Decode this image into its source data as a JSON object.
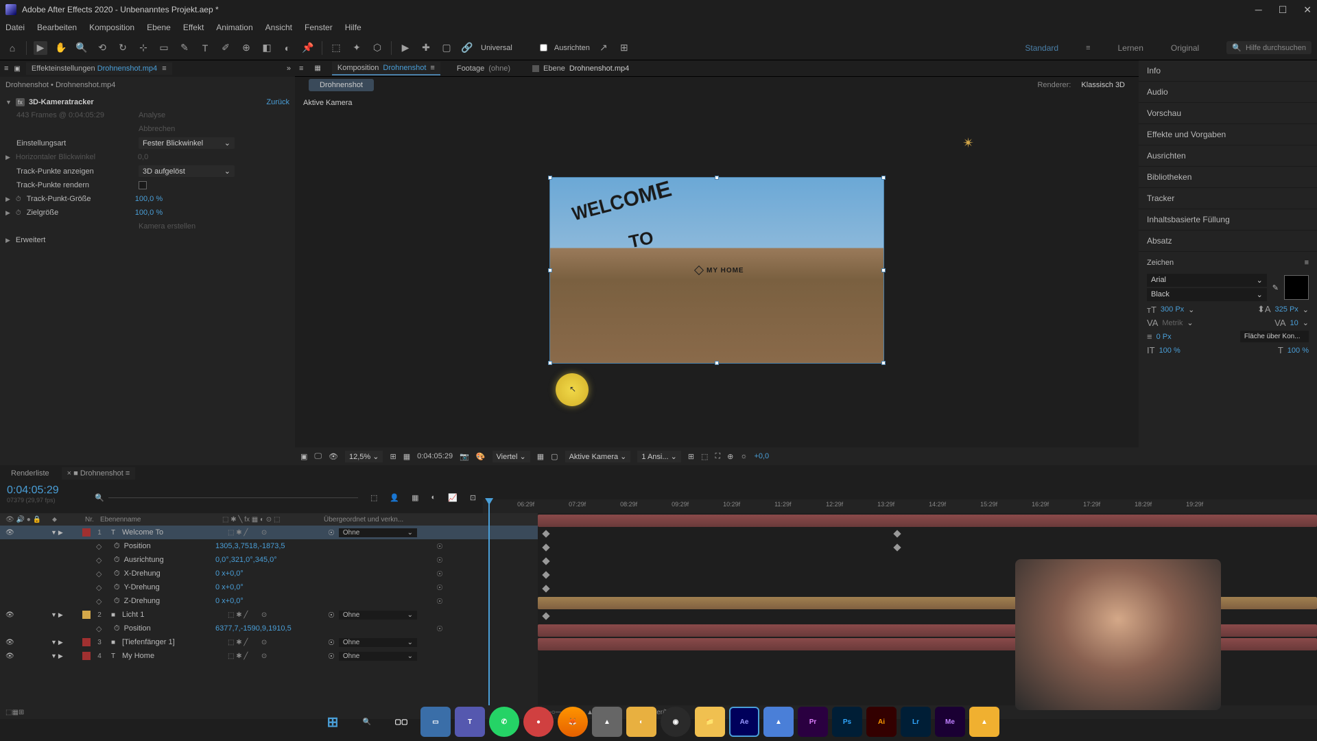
{
  "window": {
    "title": "Adobe After Effects 2020 - Unbenanntes Projekt.aep *"
  },
  "menu": [
    "Datei",
    "Bearbeiten",
    "Komposition",
    "Ebene",
    "Effekt",
    "Animation",
    "Ansicht",
    "Fenster",
    "Hilfe"
  ],
  "toolbar": {
    "universal": "Universal",
    "ausrichten": "Ausrichten",
    "workspaces": [
      "Standard",
      "Lernen",
      "Original"
    ],
    "search_placeholder": "Hilfe durchsuchen"
  },
  "left_panel": {
    "tab_label": "Effekteinstellungen",
    "tab_source": "Drohnenshot.mp4",
    "breadcrumb": "Drohnenshot • Drohnenshot.mp4",
    "effect_name": "3D-Kameratracker",
    "reset": "Zurück",
    "frames_info": "443 Frames @ 0:04:05:29",
    "analyse": "Analyse",
    "abbrechen": "Abbrechen",
    "props": {
      "einstellungsart": {
        "label": "Einstellungsart",
        "value": "Fester Blickwinkel"
      },
      "horizontaler": {
        "label": "Horizontaler Blickwinkel",
        "value": "0,0"
      },
      "trackpunkte_anzeigen": {
        "label": "Track-Punkte anzeigen",
        "value": "3D aufgelöst"
      },
      "trackpunkte_rendern": {
        "label": "Track-Punkte rendern"
      },
      "trackpunkt_groesse": {
        "label": "Track-Punkt-Größe",
        "value": "100,0 %"
      },
      "zielgroesse": {
        "label": "Zielgröße",
        "value": "100,0 %"
      },
      "kamera_erstellen": "Kamera erstellen",
      "erweitert": "Erweitert"
    }
  },
  "comp": {
    "tabs": {
      "komposition": {
        "label": "Komposition",
        "name": "Drohnenshot"
      },
      "footage": {
        "label": "Footage",
        "name": "(ohne)"
      },
      "ebene": {
        "label": "Ebene",
        "name": "Drohnenshot.mp4"
      }
    },
    "breadcrumb": "Drohnenshot",
    "renderer_label": "Renderer:",
    "renderer_value": "Klassisch 3D",
    "viewport_label": "Aktive Kamera",
    "preview_text1": "WELCOME",
    "preview_text2": "TO",
    "preview_text3": "MY HOME",
    "footer": {
      "zoom": "12,5%",
      "timecode": "0:04:05:29",
      "resolution": "Viertel",
      "camera": "Aktive Kamera",
      "views": "1 Ansi...",
      "exposure": "+0,0"
    }
  },
  "right_panel": {
    "sections": [
      "Info",
      "Audio",
      "Vorschau",
      "Effekte und Vorgaben",
      "Ausrichten",
      "Bibliotheken",
      "Tracker",
      "Inhaltsbasierte Füllung",
      "Absatz"
    ],
    "zeichen": {
      "title": "Zeichen",
      "font": "Arial",
      "style": "Black",
      "size": "300 Px",
      "leading": "325 Px",
      "kerning": "Metrik",
      "tracking": "10",
      "stroke": "0 Px",
      "fill_mode": "Fläche über Kon...",
      "vscale": "100 %",
      "hscale": "100 %"
    }
  },
  "timeline": {
    "renderliste": "Renderliste",
    "comp_name": "Drohnenshot",
    "timecode": "0:04:05:29",
    "timecode_sub": "07379 (29,97 fps)",
    "col_nr": "Nr.",
    "col_name": "Ebenenname",
    "col_parent": "Übergeordnet und verkn...",
    "ruler": [
      "06:29f",
      "07:29f",
      "08:29f",
      "09:29f",
      "10:29f",
      "11:29f",
      "12:29f",
      "13:29f",
      "14:29f",
      "15:29f",
      "16:29f",
      "17:29f",
      "18:29f",
      "19:29f"
    ],
    "layers": [
      {
        "num": "1",
        "type": "T",
        "name": "Welcome To",
        "color": "#a03030",
        "parent": "Ohne",
        "props": [
          {
            "label": "Position",
            "value": "1305,3,7518,-1873,5"
          },
          {
            "label": "Ausrichtung",
            "value": "0,0°,321,0°,345,0°"
          },
          {
            "label": "X-Drehung",
            "value": "0 x+0,0°"
          },
          {
            "label": "Y-Drehung",
            "value": "0 x+0,0°"
          },
          {
            "label": "Z-Drehung",
            "value": "0 x+0,0°"
          }
        ]
      },
      {
        "num": "2",
        "type": "",
        "name": "Licht 1",
        "color": "#d4a84a",
        "parent": "Ohne",
        "props": [
          {
            "label": "Position",
            "value": "6377,7,-1590,9,1910,5"
          }
        ]
      },
      {
        "num": "3",
        "type": "",
        "name": "[Tiefenfänger 1]",
        "color": "#a03030",
        "parent": "Ohne",
        "props": []
      },
      {
        "num": "4",
        "type": "T",
        "name": "My Home",
        "color": "#a03030",
        "parent": "Ohne",
        "props": []
      }
    ],
    "footer_center": "Schalter/Modi"
  }
}
